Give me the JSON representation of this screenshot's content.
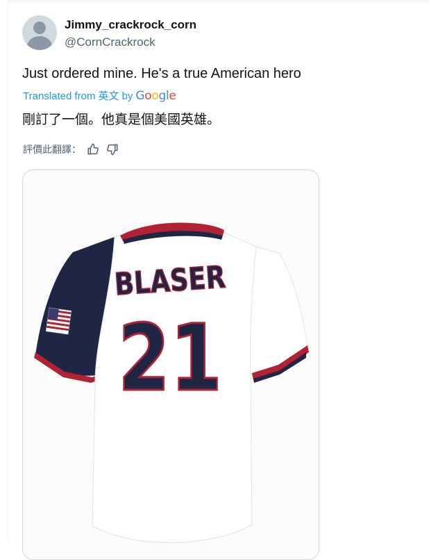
{
  "tweet": {
    "display_name": "Jimmy_crackrock_corn",
    "handle": "@CornCrackrock",
    "text": "Just ordered mine. He's a true American hero",
    "translated_from_prefix": "Translated from",
    "translated_from_lang": "英文",
    "translated_by": "by",
    "translator": "Google",
    "translation": "剛訂了一個。他真是個美國英雄。",
    "rate_label": "評價此翻譯："
  },
  "media": {
    "jersey_name": "BLASER",
    "jersey_number": "21",
    "colors": {
      "navy": "#1e2644",
      "red": "#b22234",
      "white": "#ffffff"
    }
  },
  "icons": {
    "thumbs_up": "thumbs-up-icon",
    "thumbs_down": "thumbs-down-icon"
  }
}
